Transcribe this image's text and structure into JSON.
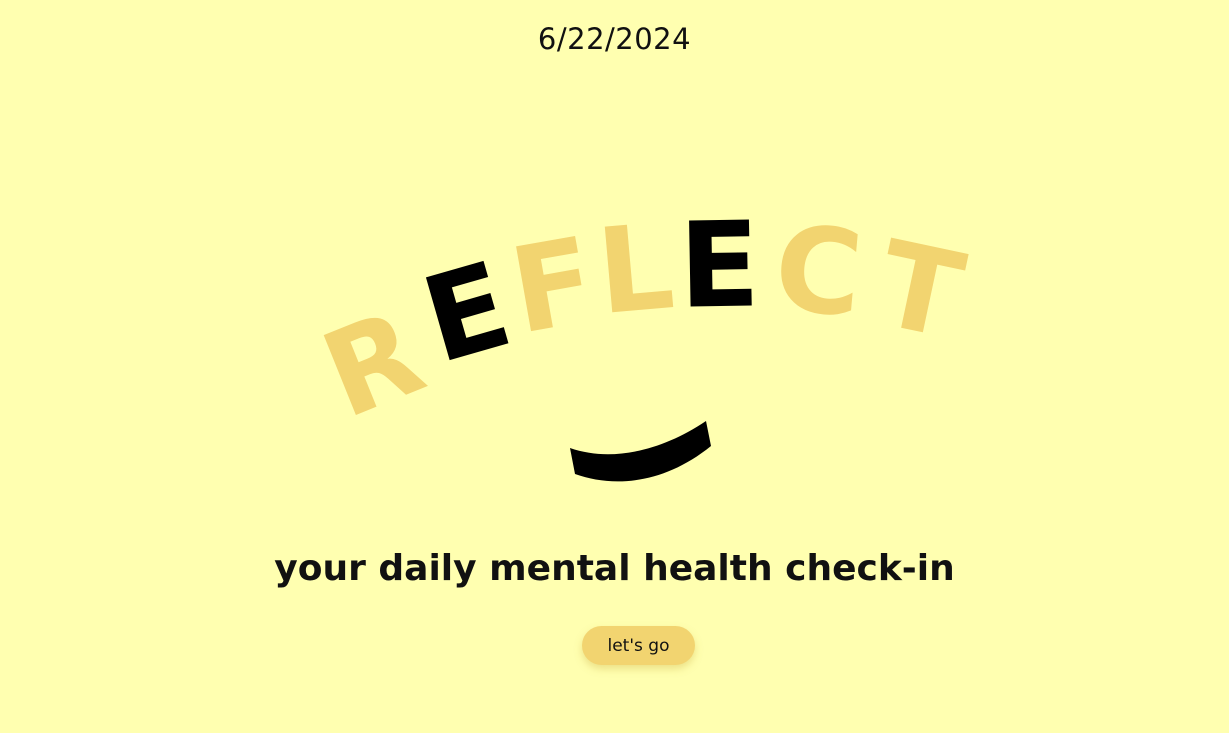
{
  "header": {
    "date": "6/22/2024"
  },
  "logo": {
    "letters": [
      "R",
      "E",
      "F",
      "L",
      "E",
      "C",
      "T"
    ],
    "accent_color": "#f2d470",
    "dark_color": "#000000"
  },
  "main": {
    "tagline": "your daily mental health check-in",
    "cta_label": "let's go"
  },
  "colors": {
    "background": "#ffffb0",
    "button": "#f2d470"
  }
}
